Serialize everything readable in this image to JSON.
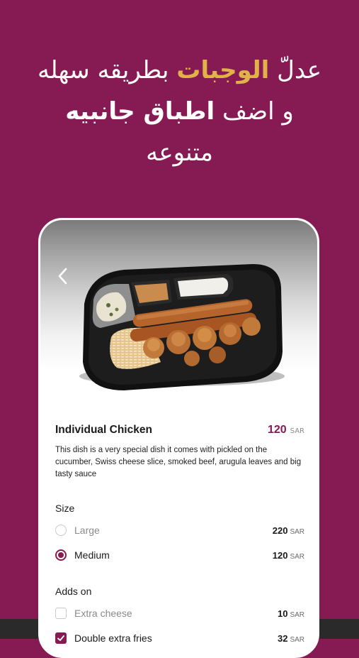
{
  "headline": {
    "line1_part1": "عدلّ",
    "line1_highlight": "الوجبات",
    "line1_part2": "بطريقه سهله",
    "line2_part1": "و اضف",
    "line2_highlight": "اطباق جانبيه",
    "line3": "متنوعه"
  },
  "product": {
    "name": "Individual Chicken",
    "price": "120",
    "currency": "SAR",
    "description": "This dish is a very special dish it comes with pickled on the cucumber, Swiss cheese slice, smoked beef, arugula leaves and big tasty sauce"
  },
  "size": {
    "label": "Size",
    "options": [
      {
        "label": "Large",
        "price": "220",
        "currency": "SAR",
        "selected": false
      },
      {
        "label": "Medium",
        "price": "120",
        "currency": "SAR",
        "selected": true
      }
    ]
  },
  "addons": {
    "label": "Adds on",
    "options": [
      {
        "label": "Extra cheese",
        "price": "10",
        "currency": "SAR",
        "checked": false
      },
      {
        "label": "Double extra fries",
        "price": "32",
        "currency": "SAR",
        "checked": true
      }
    ]
  },
  "colors": {
    "brand": "#861A52",
    "accent_gold": "#E2B24A",
    "background": "#861A52"
  },
  "icons": {
    "back": "chevron-left-icon",
    "radio": "radio-icon",
    "checkbox": "checkbox-icon"
  }
}
